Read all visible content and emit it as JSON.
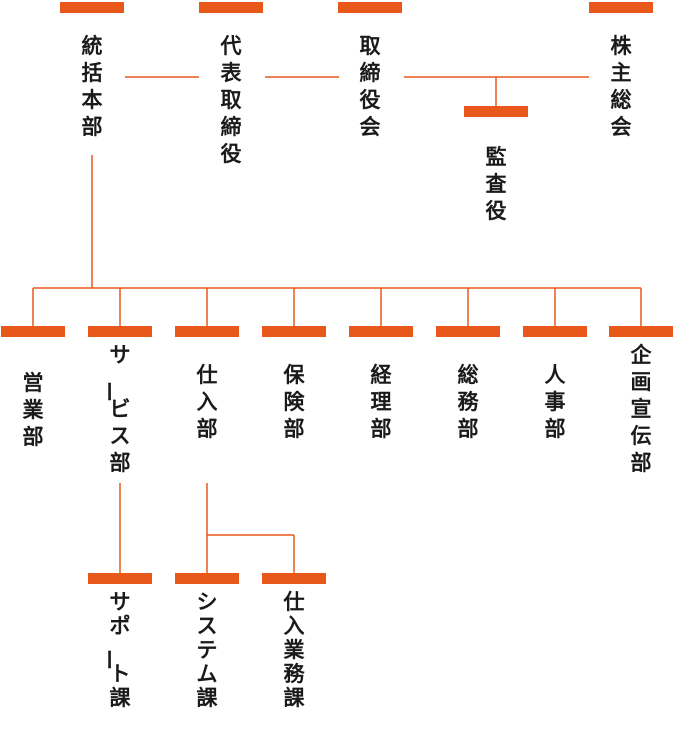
{
  "nodes": {
    "kansatsu": {
      "label": "統括本部"
    },
    "daihyo": {
      "label": "代表取締役"
    },
    "torishimari": {
      "label": "取締役会"
    },
    "kabunushi": {
      "label": "株主総会"
    },
    "kansa": {
      "label": "監査役"
    },
    "eigyo": {
      "label": "営業部"
    },
    "service": {
      "label": "サービス部"
    },
    "shiire": {
      "label": "仕入部"
    },
    "hoken": {
      "label": "保険部"
    },
    "keiri": {
      "label": "経理部"
    },
    "somu": {
      "label": "総務部"
    },
    "jinji": {
      "label": "人事部"
    },
    "kikaku": {
      "label": "企画宣伝部"
    },
    "support": {
      "label": "サポート課"
    },
    "system": {
      "label": "システム課"
    },
    "shiiregyomu": {
      "label": "仕入業務課"
    }
  }
}
